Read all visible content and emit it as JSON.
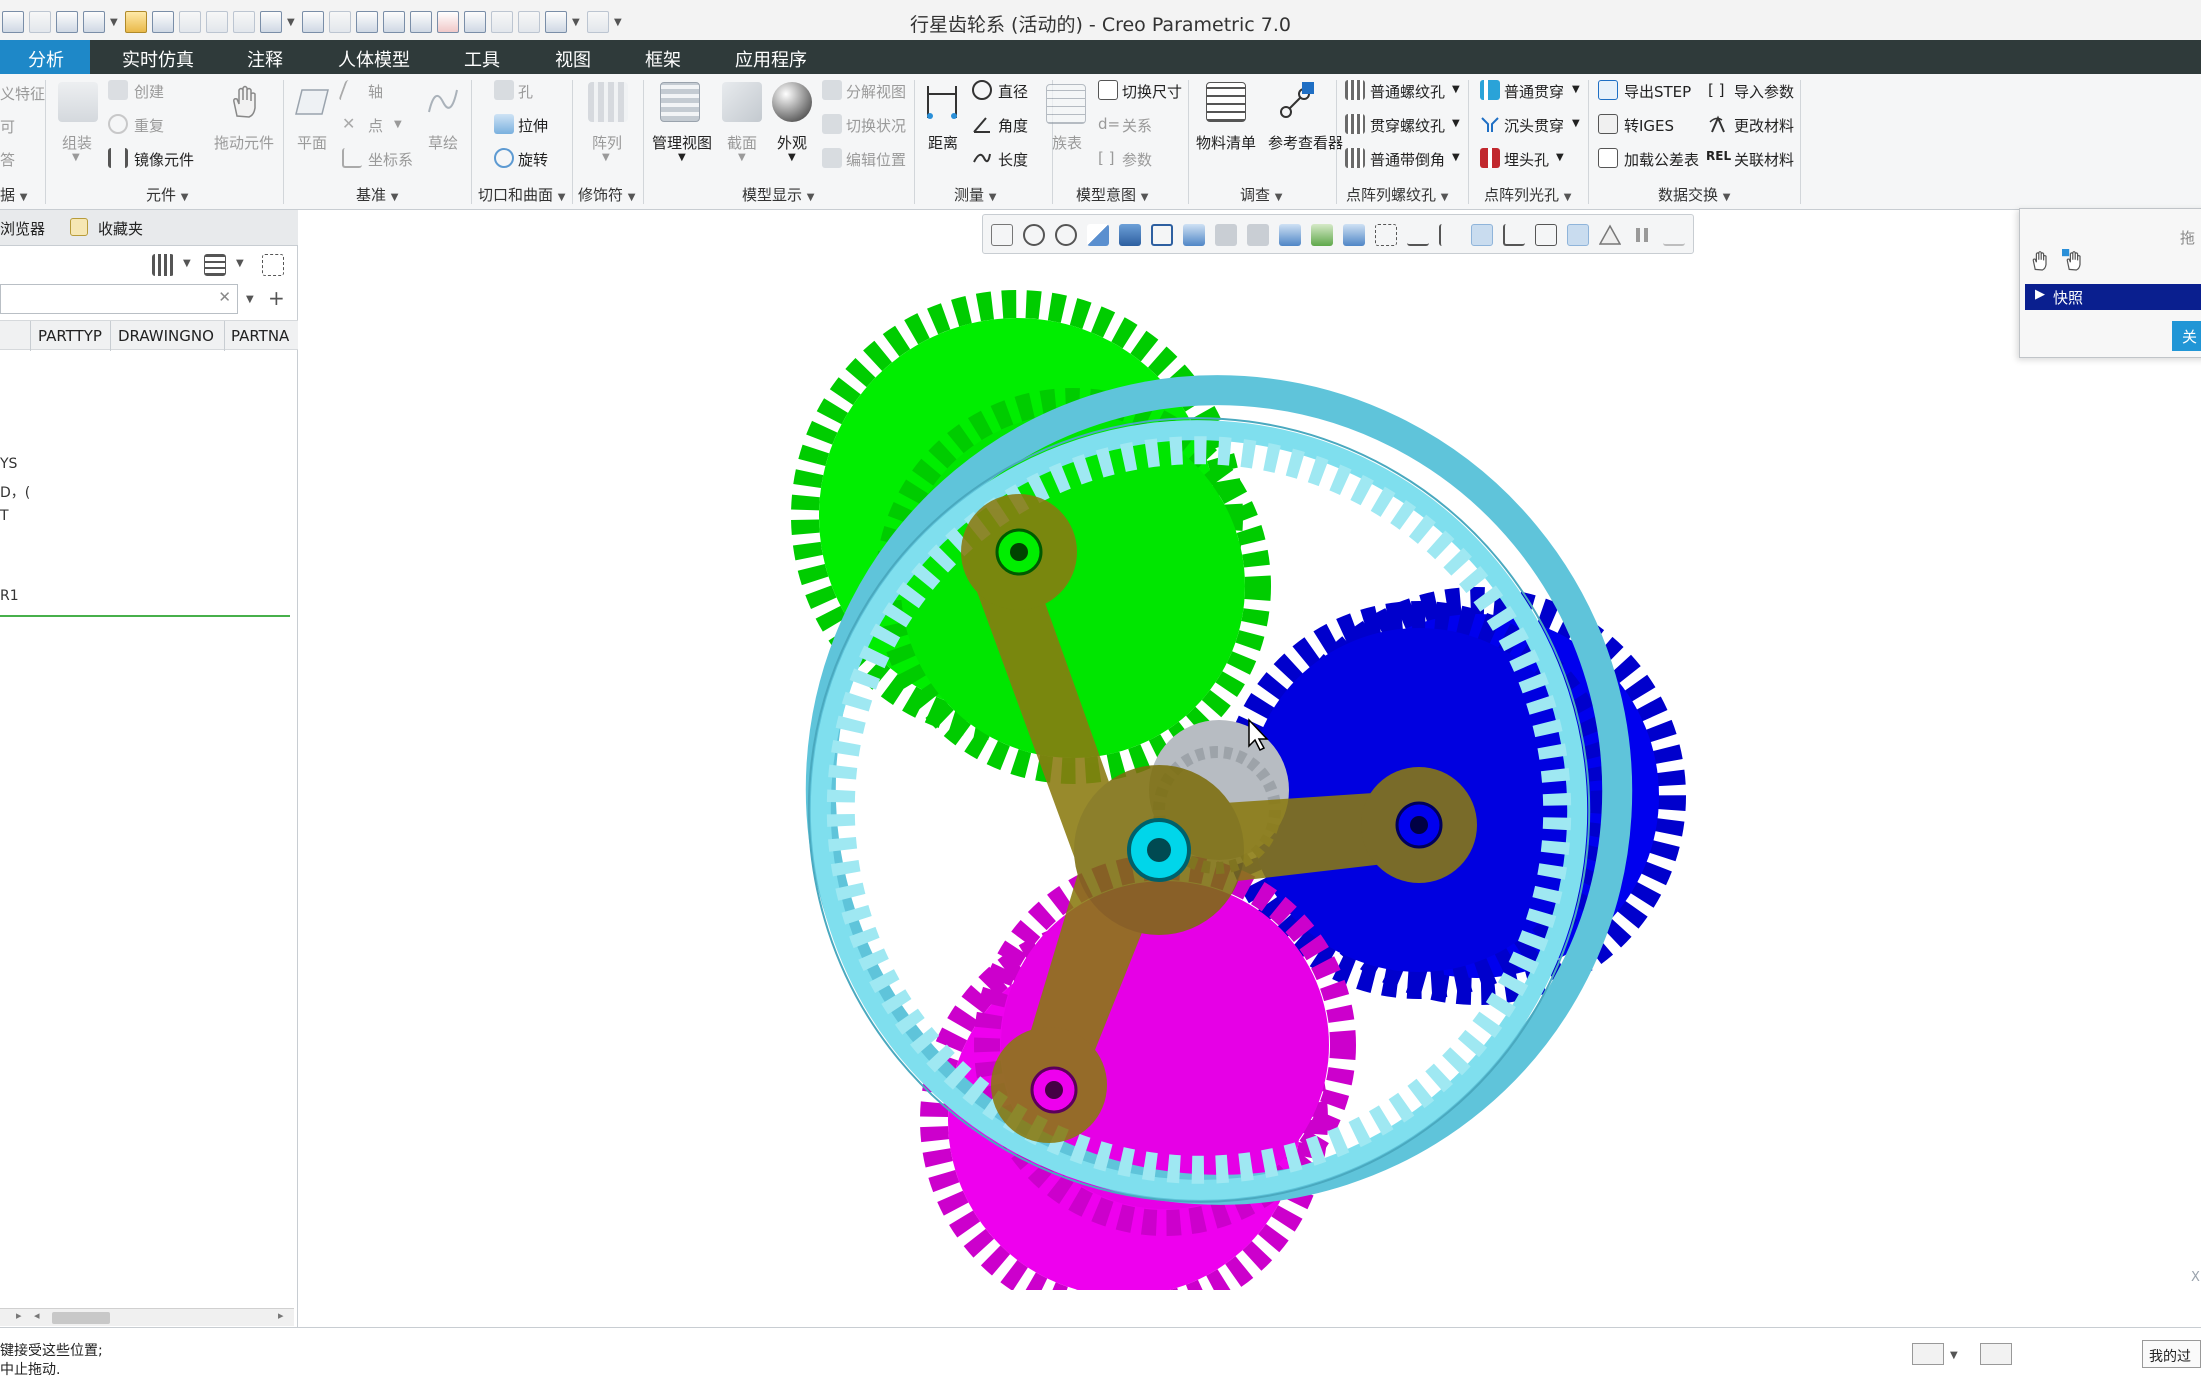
{
  "window": {
    "title": "行星齿轮系 (活动的) - Creo Parametric 7.0"
  },
  "menu": {
    "tabs": [
      "分析",
      "实时仿真",
      "注释",
      "人体模型",
      "工具",
      "视图",
      "框架",
      "应用程序"
    ]
  },
  "ribbon": {
    "operations": {
      "items": [
        "义特征",
        "可",
        "答"
      ],
      "group_label": "据"
    },
    "component": {
      "items": {
        "create": "创建",
        "repeat": "重复",
        "mirror": "镜像元件",
        "assemble": "组装",
        "drag": "拖动元件"
      },
      "group_label": "元件"
    },
    "datum": {
      "items": {
        "plane": "平面",
        "axis": "轴",
        "point": "点",
        "csys": "坐标系",
        "sketch": "草绘"
      },
      "group_label": "基准"
    },
    "cut_surface": {
      "items": {
        "hole": "孔",
        "extrude": "拉伸",
        "revolve": "旋转"
      },
      "group_label": "切口和曲面"
    },
    "modifiers": {
      "items": {
        "pattern": "阵列"
      },
      "group_label": "修饰符"
    },
    "model_display": {
      "items": {
        "manage_views": "管理视图",
        "section": "截面",
        "appearance": "外观",
        "explode": "分解视图",
        "toggle_status": "切换状况",
        "edit_position": "编辑位置"
      },
      "group_label": "模型显示"
    },
    "measure": {
      "items": {
        "distance": "距离",
        "diameter": "直径",
        "angle": "角度",
        "length": "长度"
      },
      "group_label": "测量"
    },
    "model_intent": {
      "items": {
        "family_table": "族表",
        "switch_dims": "切换尺寸",
        "relations": "关系",
        "parameters": "参数"
      },
      "group_label": "模型意图"
    },
    "investigate": {
      "items": {
        "bom": "物料清单",
        "ref_viewer": "参考查看器"
      },
      "group_label": "调查"
    },
    "thread_pattern": {
      "items": {
        "std_thread": "普通螺纹孔",
        "thru_thread": "贯穿螺纹孔",
        "std_chamfer": "普通带倒角"
      },
      "group_label": "点阵列螺纹孔"
    },
    "clear_pattern": {
      "items": {
        "std_thru": "普通贯穿",
        "countersink": "沉头贯穿",
        "counterbore": "埋头孔"
      },
      "group_label": "点阵列光孔"
    },
    "data_exchange": {
      "items": {
        "export_step": "导出STEP",
        "to_iges": "转IGES",
        "load_tolerance": "加载公差表",
        "import_params": "导入参数",
        "change_material": "更改材料",
        "link_material": "关联材料"
      },
      "group_label": "数据交换"
    }
  },
  "left_panel": {
    "tabs": {
      "browser": "浏览器",
      "favorites": "收藏夹"
    },
    "search_placeholder": "",
    "columns": [
      "PARTTYP",
      "DRAWINGNO",
      "PARTNA"
    ],
    "tree_fragments": [
      "YS",
      "D，(",
      "T",
      "R1"
    ]
  },
  "graphics": {
    "watermark": "X"
  },
  "drag_dialog": {
    "title": "拖",
    "snapshot_label": "快照",
    "close_label": "关"
  },
  "status": {
    "line1": "键接受这些位置;",
    "line2": "中止拖动.",
    "right_label": "我的过"
  },
  "colors": {
    "menubar": "#2f3a3a",
    "active_tab": "#1e88c8",
    "ring_gear": "#7fdfee",
    "planet_green": "#00ee00",
    "planet_blue": "#0000ee",
    "planet_magenta": "#ee00ee",
    "carrier": "#8a7a10",
    "sun": "#00d6ea"
  }
}
